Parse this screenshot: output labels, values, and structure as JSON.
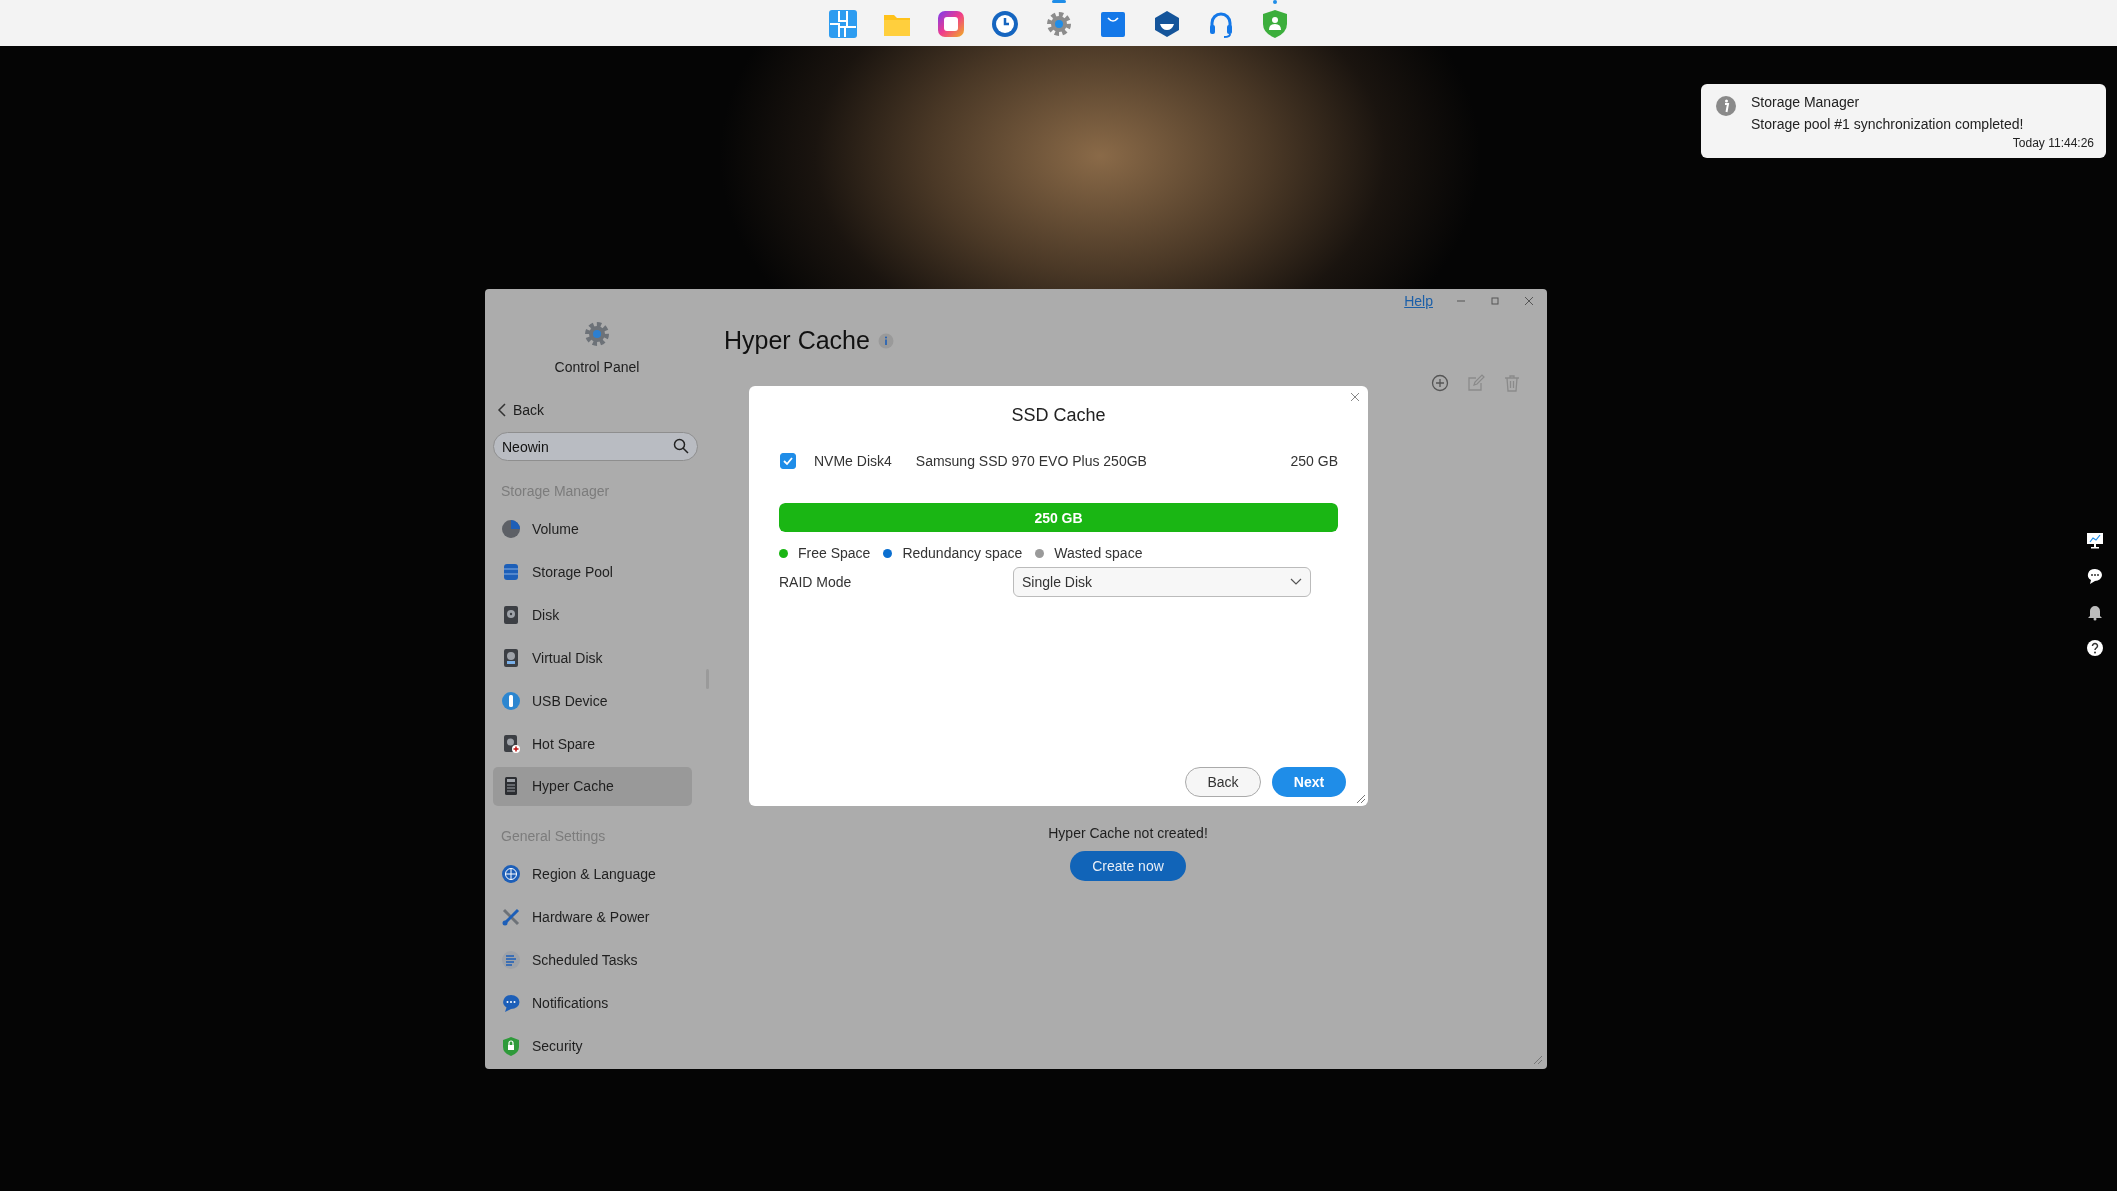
{
  "taskbar": {
    "apps": [
      {
        "active": false,
        "alert": false
      },
      {
        "active": false,
        "alert": false
      },
      {
        "active": false,
        "alert": false
      },
      {
        "active": false,
        "alert": false
      },
      {
        "active": true,
        "alert": false
      },
      {
        "active": false,
        "alert": false
      },
      {
        "active": false,
        "alert": false
      },
      {
        "active": false,
        "alert": false
      },
      {
        "active": false,
        "alert": true
      }
    ]
  },
  "notification": {
    "title": "Storage Manager",
    "message": "Storage pool #1 synchronization completed!",
    "time": "Today 11:44:26"
  },
  "window": {
    "help": "Help",
    "sidebar": {
      "app_title": "Control Panel",
      "back": "Back",
      "search": {
        "value": "Neowin"
      },
      "sections": [
        {
          "heading": "Storage Manager",
          "items": [
            {
              "label": "Volume",
              "selected": false
            },
            {
              "label": "Storage Pool",
              "selected": false
            },
            {
              "label": "Disk",
              "selected": false
            },
            {
              "label": "Virtual Disk",
              "selected": false
            },
            {
              "label": "USB Device",
              "selected": false
            },
            {
              "label": "Hot Spare",
              "selected": false
            },
            {
              "label": "Hyper Cache",
              "selected": true
            }
          ]
        },
        {
          "heading": "General Settings",
          "items": [
            {
              "label": "Region & Language",
              "selected": false
            },
            {
              "label": "Hardware & Power",
              "selected": false
            },
            {
              "label": "Scheduled Tasks",
              "selected": false
            },
            {
              "label": "Notifications",
              "selected": false
            },
            {
              "label": "Security",
              "selected": false
            }
          ]
        }
      ]
    },
    "main": {
      "title": "Hyper Cache",
      "empty_message": "Hyper Cache not created!",
      "create_button": "Create now"
    },
    "dialog": {
      "title": "SSD Cache",
      "disks": [
        {
          "checked": true,
          "name": "NVMe Disk4",
          "model": "Samsung SSD 970 EVO Plus 250GB",
          "size": "250 GB"
        }
      ],
      "capacity_bar": {
        "label": "250 GB",
        "level": 1
      },
      "legend": [
        {
          "label": "Free Space",
          "color": "#1ab614"
        },
        {
          "label": "Redundancy space",
          "color": "#0b6fd0"
        },
        {
          "label": "Wasted space",
          "color": "#9a9a9a"
        }
      ],
      "raid_mode": {
        "label": "RAID Mode",
        "value": "Single Disk"
      },
      "buttons": [
        {
          "label": "Back",
          "kind": "secondary"
        },
        {
          "label": "Next",
          "kind": "primary"
        }
      ]
    }
  }
}
